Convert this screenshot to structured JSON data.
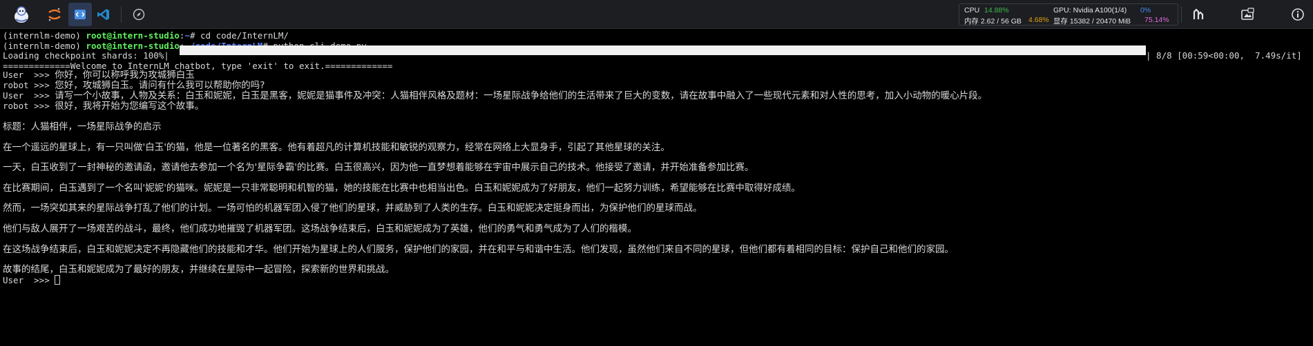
{
  "toolbar": {
    "icons": [
      "logo-icon",
      "jupyter-icon",
      "code-server-icon",
      "vscode-icon",
      "compass-icon"
    ],
    "cpu_label": "CPU",
    "cpu_value": "14.88%",
    "gpu_label": "GPU: Nvidia A100(1/4)",
    "gpu_value": "0%",
    "mem_label": "内存 2.62 / 56 GB",
    "mem_value": "4.68%",
    "vram_label": "显存 15382 / 20470 MiB",
    "vram_value": "75.14%",
    "right_icons": [
      "scale-icon",
      "screenshot-icon",
      "info-icon"
    ]
  },
  "terminal": {
    "env": "(internlm-demo)",
    "user_host": "root@intern-studio",
    "path1": "~",
    "cmd1": "# cd code/InternLM/",
    "path2": "~/code/InternLM",
    "cmd2": "# python cli_demo.py",
    "loading_label": "Loading checkpoint shards: 100%|",
    "loading_stats": "| 8/8 [00:59<00:00,  7.49s/it]",
    "loading_progress": 1.0,
    "welcome": "=============Welcome to InternLM chatbot, type 'exit' to exit.=============",
    "user_prefix": "User  >>> ",
    "robot_prefix": "robot >>> ",
    "msg1": "你好，你可以称呼我为攻城狮白玉",
    "reply1": "您好，攻城狮白玉。请问有什么我可以帮助你的吗?",
    "msg2": "请写一个小故事，人物及关系：白玉和妮妮，白玉是黑客，妮妮是猫事件及冲突：人猫相伴风格及题材：一场星际战争给他们的生活带来了巨大的变数，请在故事中融入了一些现代元素和对人性的思考，加入小动物的暖心片段。",
    "reply2": "很好，我将开始为您编写这个故事。",
    "story": [
      "标题：人猫相伴，一场星际战争的启示",
      "在一个遥远的星球上，有一只叫做'白玉'的猫，他是一位著名的黑客。他有着超凡的计算机技能和敏锐的观察力，经常在网络上大显身手，引起了其他星球的关注。",
      "一天，白玉收到了一封神秘的邀请函，邀请他去参加一个名为'星际争霸'的比赛。白玉很高兴，因为他一直梦想着能够在宇宙中展示自己的技术。他接受了邀请，并开始准备参加比赛。",
      "在比赛期间，白玉遇到了一个名叫'妮妮'的猫咪。妮妮是一只非常聪明和机智的猫，她的技能在比赛中也相当出色。白玉和妮妮成为了好朋友，他们一起努力训练，希望能够在比赛中取得好成绩。",
      "然而，一场突如其来的星际战争打乱了他们的计划。一场可怕的机器军团入侵了他们的星球，并威胁到了人类的生存。白玉和妮妮决定挺身而出，为保护他们的星球而战。",
      "他们与敌人展开了一场艰苦的战斗，最终，他们成功地摧毁了机器军团。这场战争结束后，白玉和妮妮成为了英雄，他们的勇气和勇气成为了人们的楷模。",
      "在这场战争结束后，白玉和妮妮决定不再隐藏他们的技能和才华。他们开始为星球上的人们服务，保护他们的家园，并在和平与和谐中生活。他们发现，虽然他们来自不同的星球，但他们都有着相同的目标：保护自己和他们的家园。",
      "故事的结尾，白玉和妮妮成为了最好的朋友，并继续在星际中一起冒险，探索新的世界和挑战。"
    ],
    "prompt_last": "User  >>> "
  }
}
